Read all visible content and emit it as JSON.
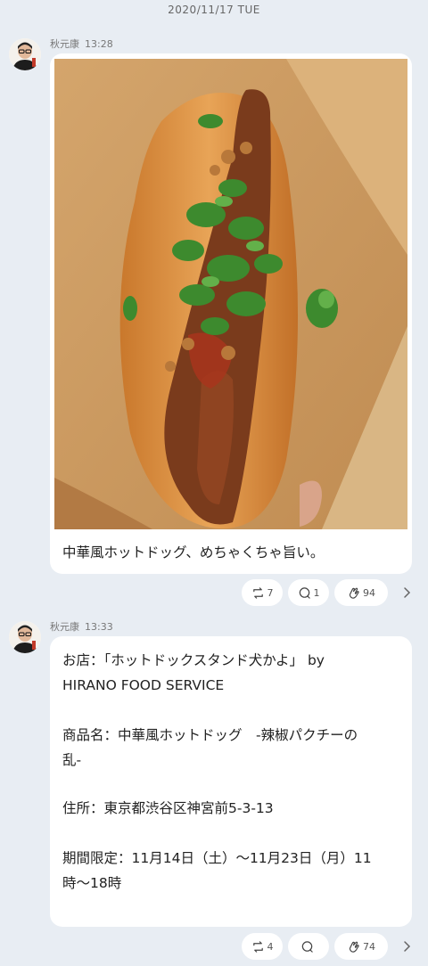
{
  "date_header": "2020/11/17 TUE",
  "messages": [
    {
      "author": "秋元康",
      "time": "13:28",
      "caption": "中華風ホットドッグ、めちゃくちゃ旨い。",
      "reactions": {
        "repost": "7",
        "comment": "1",
        "clap": "94"
      }
    },
    {
      "author": "秋元康",
      "time": "13:33",
      "lines": [
        "お店：「ホットドックスタンド犬かよ」 by",
        "HIRANO FOOD SERVICE",
        "",
        "商品名：中華風ホットドッグ　-辣椒パクチーの",
        "乱-",
        "",
        "住所：東京都渋谷区神宮前5-3-13",
        "",
        "期間限定：11月14日（土）〜11月23日（月）11",
        "時〜18時"
      ],
      "reactions": {
        "repost": "4",
        "comment": "",
        "clap": "74"
      }
    }
  ]
}
